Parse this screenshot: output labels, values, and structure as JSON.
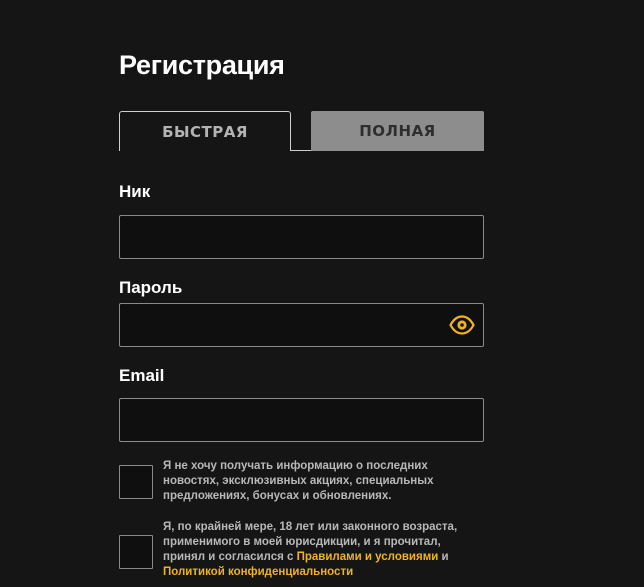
{
  "form": {
    "title": "Регистрация",
    "tabs": [
      {
        "label": "БЫСТРАЯ",
        "active": true
      },
      {
        "label": "ПОЛНАЯ",
        "active": false
      }
    ],
    "fields": {
      "nick": {
        "label": "Ник",
        "value": "",
        "placeholder": ""
      },
      "password": {
        "label": "Пароль",
        "value": "",
        "placeholder": "",
        "toggle_icon": "eye-icon"
      },
      "email": {
        "label": "Email",
        "value": "",
        "placeholder": ""
      }
    },
    "checkboxes": {
      "newsletter": {
        "checked": false,
        "text": "Я не хочу получать информацию о последних новостях, эксклюзивных акциях, специальных предложениях, бонусах и обновлениях."
      },
      "age": {
        "checked": false,
        "text_before": "Я, по крайней мере, 18 лет или законного возраста, применимого в моей юрисдикции, и я прочитал, принял и согласился с ",
        "terms_link": "Правилами и условиями",
        "text_middle": " и ",
        "privacy_link": "Политикой конфиденциальности"
      }
    }
  },
  "colors": {
    "background": "#151515",
    "accent": "#f0b21e",
    "tab_inactive": "#8d8d8d",
    "border": "#8a8a8a"
  }
}
